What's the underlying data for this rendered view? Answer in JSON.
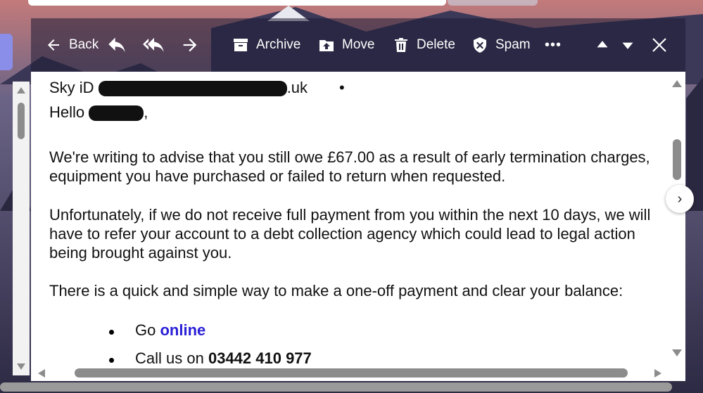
{
  "toolbar": {
    "back_label": "Back",
    "archive_label": "Archive",
    "move_label": "Move",
    "delete_label": "Delete",
    "spam_label": "Spam",
    "more_label": "•••",
    "close_label": "✕"
  },
  "email": {
    "from_prefix": "Sky iD",
    "from_suffix": ".uk",
    "separator": "•",
    "greeting_prefix": "Hello",
    "greeting_suffix": ",",
    "paragraph1": "We're writing to advise that you still owe £67.00 as a result of early termination charges, equipment you have purchased or failed to return when requested.",
    "paragraph2": "Unfortunately, if we do not receive full payment from you within the next 10 days, we will have to refer your account to a debt collection agency which could lead to legal action being brought against you.",
    "paragraph3": "There is a quick and simple way to make a one-off payment and clear your balance:",
    "list": {
      "item1_prefix": "Go",
      "item1_link": "online",
      "item2_prefix": "Call us on",
      "item2_phone": "03442 410 977"
    }
  },
  "nav": {
    "next_label": "›"
  },
  "colors": {
    "toolbar_bg": "#1e1c34",
    "link": "#2a1fd6",
    "text": "#111111",
    "scrollbar": "#8c8c8c"
  }
}
